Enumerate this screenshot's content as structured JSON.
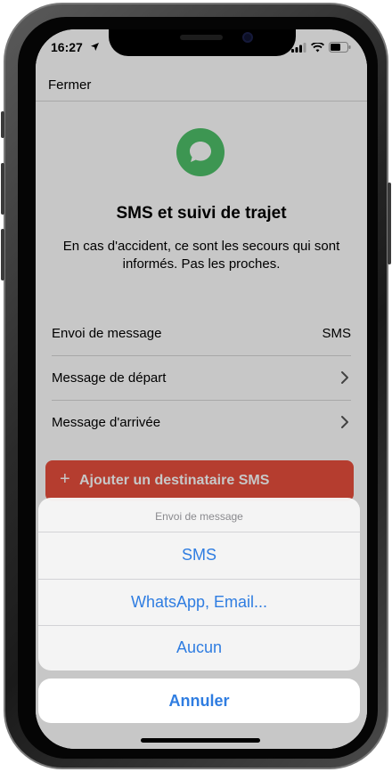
{
  "status_bar": {
    "time": "16:27"
  },
  "header": {
    "close_label": "Fermer"
  },
  "intro": {
    "title": "SMS et suivi de trajet",
    "description": "En cas d'accident, ce sont les secours qui sont informés. Pas les proches."
  },
  "settings": {
    "rows": [
      {
        "label": "Envoi de message",
        "value": "SMS"
      },
      {
        "label": "Message de départ"
      },
      {
        "label": "Message d'arrivée"
      }
    ]
  },
  "add_recipient": {
    "icon": "+",
    "label": "Ajouter un destinataire SMS"
  },
  "action_sheet": {
    "title": "Envoi de message",
    "options": [
      "SMS",
      "WhatsApp, Email...",
      "Aucun"
    ],
    "cancel_label": "Annuler"
  },
  "colors": {
    "accent_blue": "#2f7de1",
    "danger_red": "#e84f3d",
    "icon_green": "#4fc06a"
  }
}
